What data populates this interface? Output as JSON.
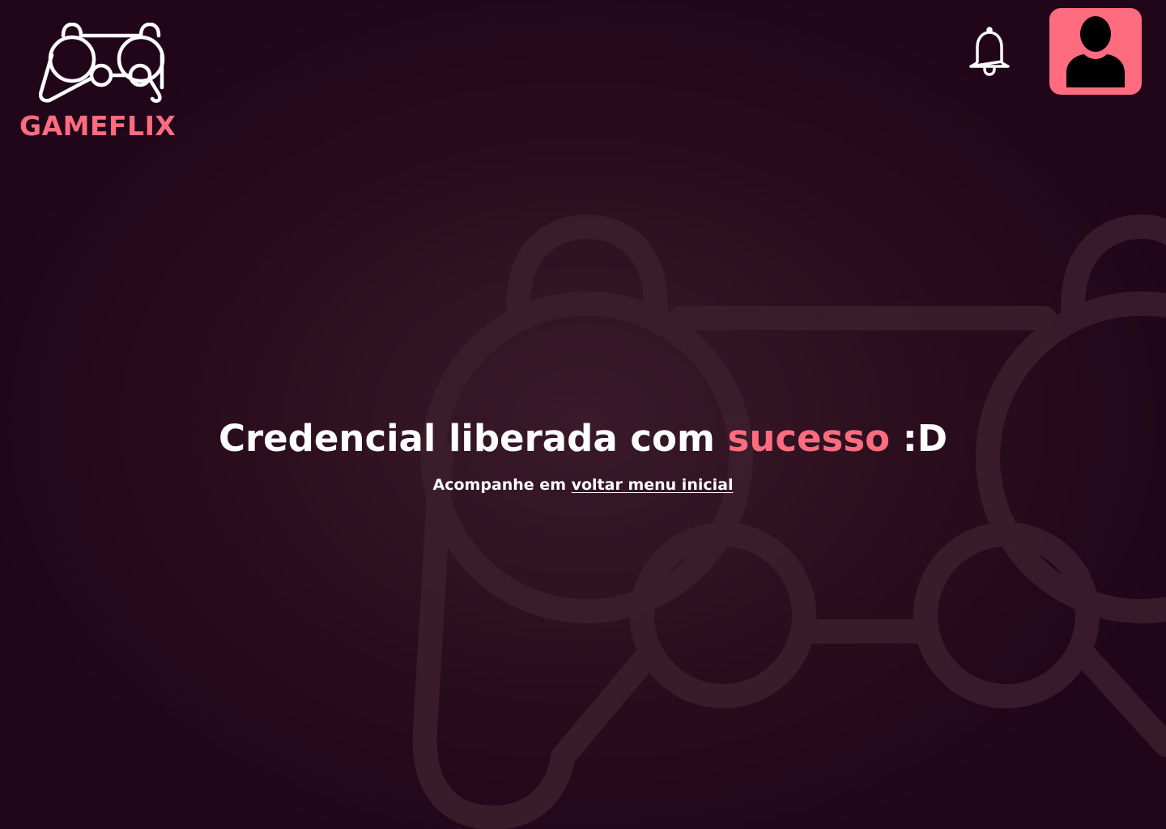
{
  "brand": {
    "name": "GAMEFLIX",
    "logo_icon": "gamepad-icon",
    "accent_color": "#ff6c80"
  },
  "header": {
    "notification_icon": "bell-icon",
    "profile_icon": "user-icon"
  },
  "main": {
    "headline_part1": "Credencial liberada com ",
    "headline_highlight": "sucesso",
    "headline_part2": " :D",
    "subline_prefix": "Acompanhe em ",
    "subline_link": "voltar menu inicial"
  },
  "background": {
    "decoration_icon": "gamepad-outline-watermark",
    "background_color": "#2b0e1d"
  }
}
